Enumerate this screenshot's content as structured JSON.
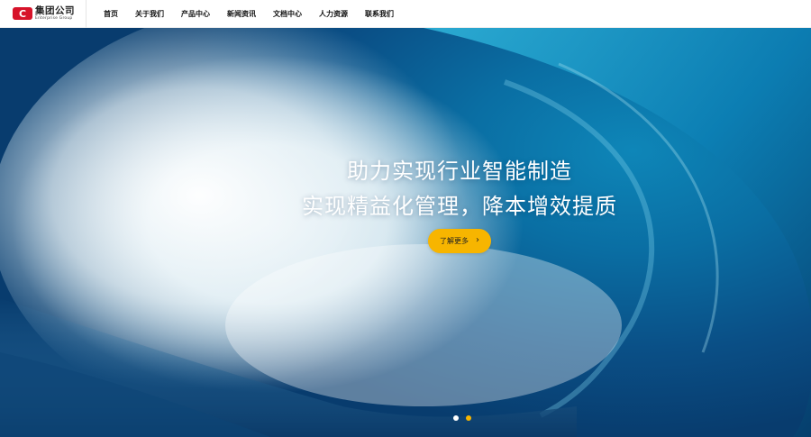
{
  "header": {
    "logo": {
      "mark": "C",
      "name_cn": "集团公司",
      "name_en": "Enterprise Group"
    },
    "nav": [
      {
        "label": "首页"
      },
      {
        "label": "关于我们"
      },
      {
        "label": "产品中心"
      },
      {
        "label": "新闻资讯"
      },
      {
        "label": "文档中心"
      },
      {
        "label": "人力资源"
      },
      {
        "label": "联系我们"
      }
    ]
  },
  "hero": {
    "headline_1": "助力实现行业智能制造",
    "headline_2": "实现精益化管理，降本增效提质",
    "cta_label": "了解更多",
    "cta_icon": "chevron-right-icon",
    "carousel": {
      "slides": 2,
      "active_index": 1
    }
  },
  "colors": {
    "brand": "#d7132a",
    "cta": "#f7b500",
    "dot_inactive": "#ffffff",
    "dot_active": "#f7b500"
  }
}
